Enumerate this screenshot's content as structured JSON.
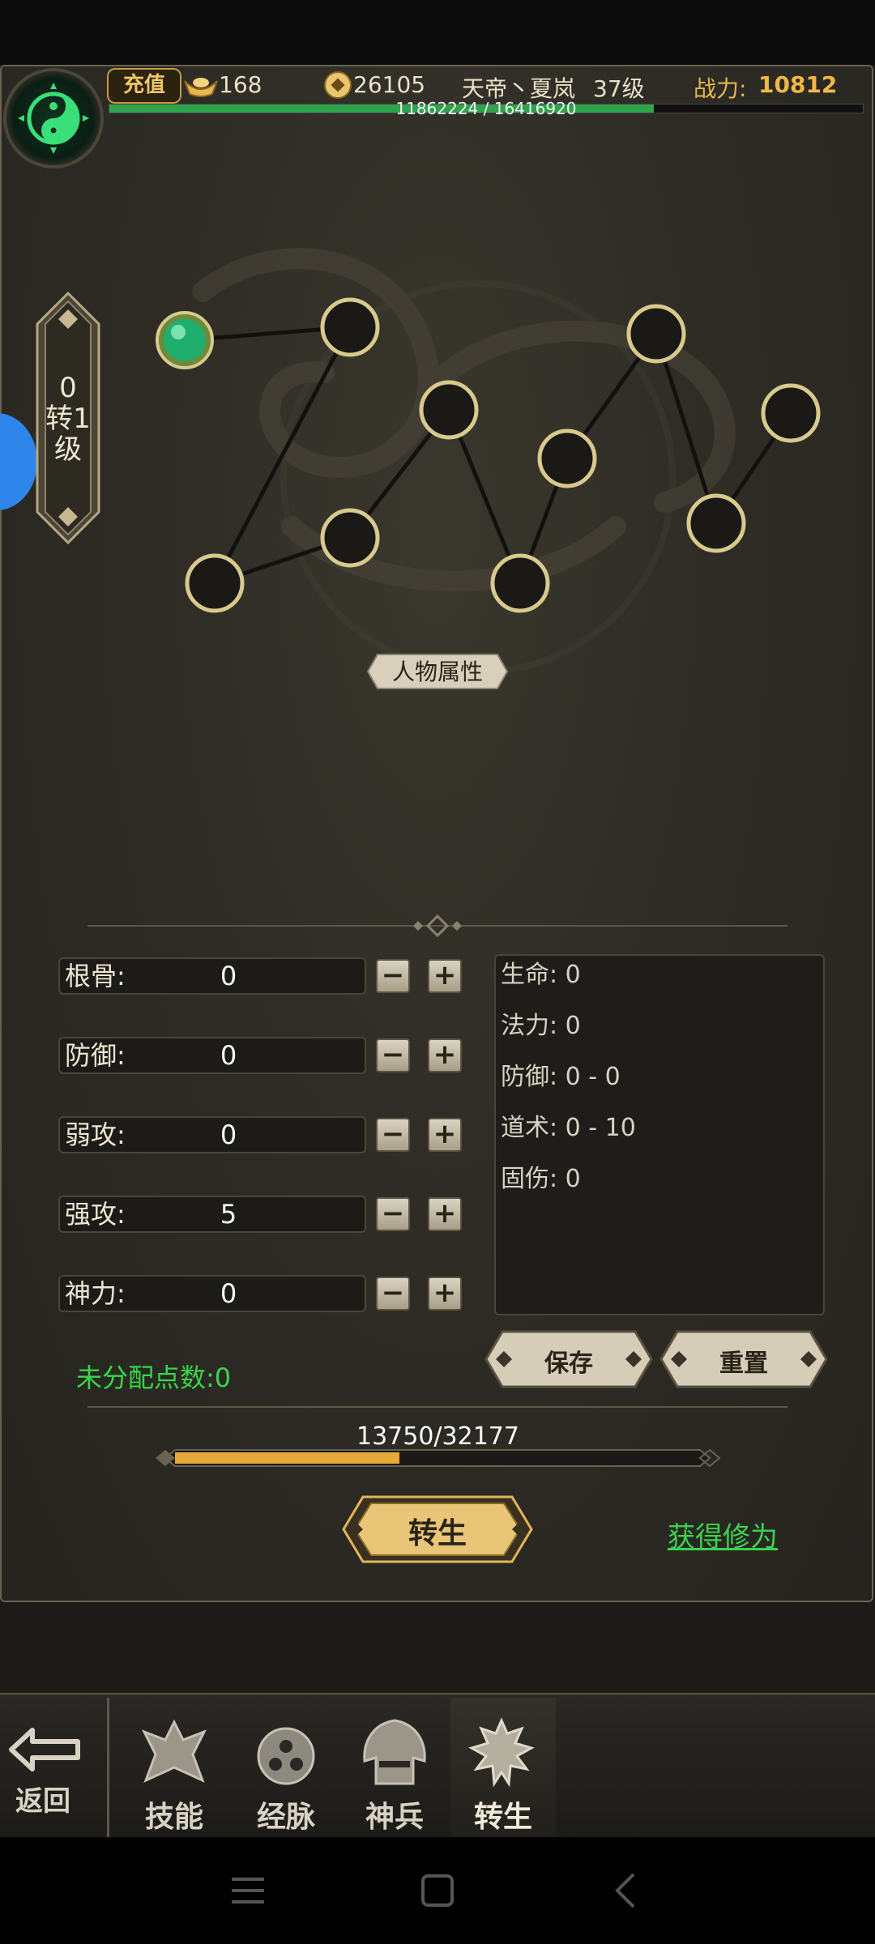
{
  "top_bar": {
    "recharge_label": "充值",
    "ingot_count": "168",
    "coin_count": "26105",
    "player_name": "天帝丶夏岚",
    "level": "37级",
    "power_label": "战力:",
    "power_value": "10812",
    "exp_text": "11862224 / 16416920",
    "exp_fraction": 0.7226
  },
  "rebirth_badge": {
    "line1": "0",
    "line2": "转1",
    "line3": "级"
  },
  "attribute_title": "人物属性",
  "stats": [
    {
      "label": "根骨:",
      "value": "0"
    },
    {
      "label": "防御:",
      "value": "0"
    },
    {
      "label": "弱攻:",
      "value": "0"
    },
    {
      "label": "强攻:",
      "value": "5"
    },
    {
      "label": "神力:",
      "value": "0"
    }
  ],
  "minus_symbol": "−",
  "plus_symbol": "+",
  "derived": [
    "生命: 0",
    "法力: 0",
    "防御: 0 - 0",
    "道术: 0 - 10",
    "固伤: 0"
  ],
  "unassigned_points": "未分配点数:0",
  "save_label": "保存",
  "reset_label": "重置",
  "progress": {
    "text": "13750/32177",
    "fraction": 0.4273
  },
  "rebirth_button_label": "转生",
  "get_xiuwei_label": "获得修为",
  "dock": {
    "back_label": "返回",
    "tabs": [
      "技能",
      "经脉",
      "神兵",
      "转生"
    ]
  },
  "colors": {
    "accent_green": "#38d64a",
    "gold": "#e9b64d",
    "panel_bg": "#2e2c25"
  }
}
